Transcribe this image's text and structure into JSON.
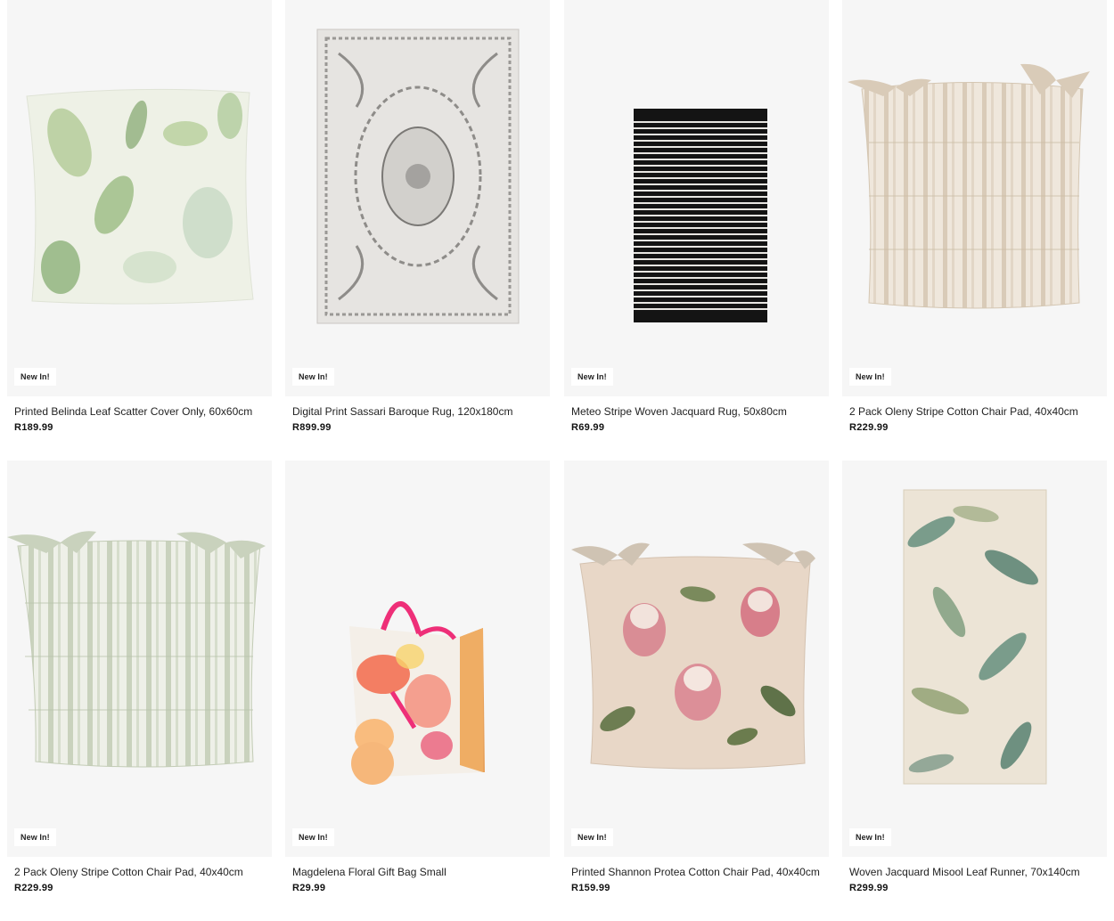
{
  "products": [
    {
      "badge": "New In!",
      "title": "Printed Belinda Leaf Scatter Cover Only, 60x60cm",
      "price": "R189.99"
    },
    {
      "badge": "New In!",
      "title": "Digital Print Sassari Baroque Rug, 120x180cm",
      "price": "R899.99"
    },
    {
      "badge": "New In!",
      "title": "Meteo Stripe Woven Jacquard Rug, 50x80cm",
      "price": "R69.99"
    },
    {
      "badge": "New In!",
      "title": "2 Pack Oleny Stripe Cotton Chair Pad, 40x40cm",
      "price": "R229.99"
    },
    {
      "badge": "New In!",
      "title": "2 Pack Oleny Stripe Cotton Chair Pad, 40x40cm",
      "price": "R229.99"
    },
    {
      "badge": "New In!",
      "title": "Magdelena Floral Gift Bag Small",
      "price": "R29.99"
    },
    {
      "badge": "New In!",
      "title": "Printed Shannon Protea Cotton Chair Pad, 40x40cm",
      "price": "R159.99"
    },
    {
      "badge": "New In!",
      "title": "Woven Jacquard Misool Leaf Runner, 70x140cm",
      "price": "R299.99"
    }
  ]
}
